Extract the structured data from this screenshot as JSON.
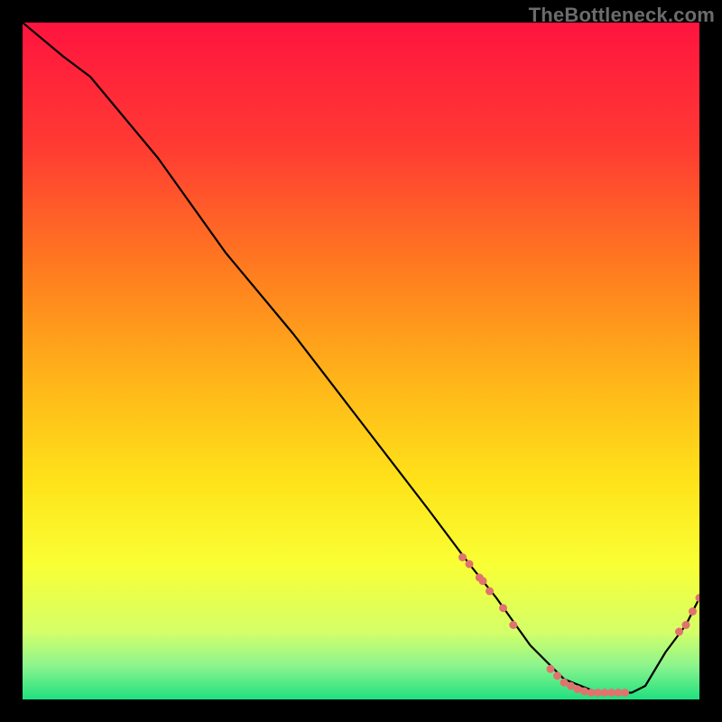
{
  "watermark": "TheBottleneck.com",
  "colors": {
    "gradient_stops": [
      {
        "offset": 0.0,
        "color": "#ff143f"
      },
      {
        "offset": 0.18,
        "color": "#ff3a33"
      },
      {
        "offset": 0.36,
        "color": "#ff7a20"
      },
      {
        "offset": 0.52,
        "color": "#ffb219"
      },
      {
        "offset": 0.68,
        "color": "#ffe31a"
      },
      {
        "offset": 0.8,
        "color": "#f9ff34"
      },
      {
        "offset": 0.9,
        "color": "#d5ff68"
      },
      {
        "offset": 0.95,
        "color": "#8cf48d"
      },
      {
        "offset": 1.0,
        "color": "#1fe07f"
      }
    ],
    "line": "#000000",
    "marker": "#e0736e"
  },
  "chart_data": {
    "type": "line",
    "title": "",
    "xlabel": "",
    "ylabel": "",
    "xlim": [
      0,
      100
    ],
    "ylim": [
      0,
      100
    ],
    "series": [
      {
        "name": "bottleneck-curve",
        "x": [
          0,
          6,
          10,
          20,
          30,
          40,
          50,
          60,
          66,
          70,
          75,
          80,
          85,
          90,
          92,
          95,
          98,
          100
        ],
        "y": [
          100,
          95,
          92,
          80,
          66,
          54,
          41,
          28,
          20,
          15,
          8,
          3,
          1,
          1,
          2,
          7,
          11,
          15
        ]
      }
    ],
    "markers": [
      {
        "group": "cluster-mid",
        "points": [
          {
            "x": 65,
            "y": 21
          },
          {
            "x": 66,
            "y": 20
          },
          {
            "x": 67.5,
            "y": 18
          },
          {
            "x": 68,
            "y": 17.5
          },
          {
            "x": 69,
            "y": 16
          },
          {
            "x": 71,
            "y": 13.5
          },
          {
            "x": 72.5,
            "y": 11
          }
        ],
        "size": 4.5
      },
      {
        "group": "cluster-bottom",
        "points": [
          {
            "x": 78,
            "y": 4.5
          },
          {
            "x": 79,
            "y": 3.5
          },
          {
            "x": 80,
            "y": 2.5
          },
          {
            "x": 81,
            "y": 2.0
          },
          {
            "x": 82,
            "y": 1.5
          },
          {
            "x": 83,
            "y": 1.2
          },
          {
            "x": 84,
            "y": 1.0
          },
          {
            "x": 85,
            "y": 1.0
          },
          {
            "x": 86,
            "y": 1.0
          },
          {
            "x": 87,
            "y": 1.0
          },
          {
            "x": 88,
            "y": 1.0
          },
          {
            "x": 89,
            "y": 1.0
          }
        ],
        "size": 4.5
      },
      {
        "group": "cluster-right",
        "points": [
          {
            "x": 97,
            "y": 10
          },
          {
            "x": 98,
            "y": 11
          },
          {
            "x": 99,
            "y": 13
          },
          {
            "x": 100,
            "y": 15
          }
        ],
        "size": 4.5
      }
    ]
  }
}
